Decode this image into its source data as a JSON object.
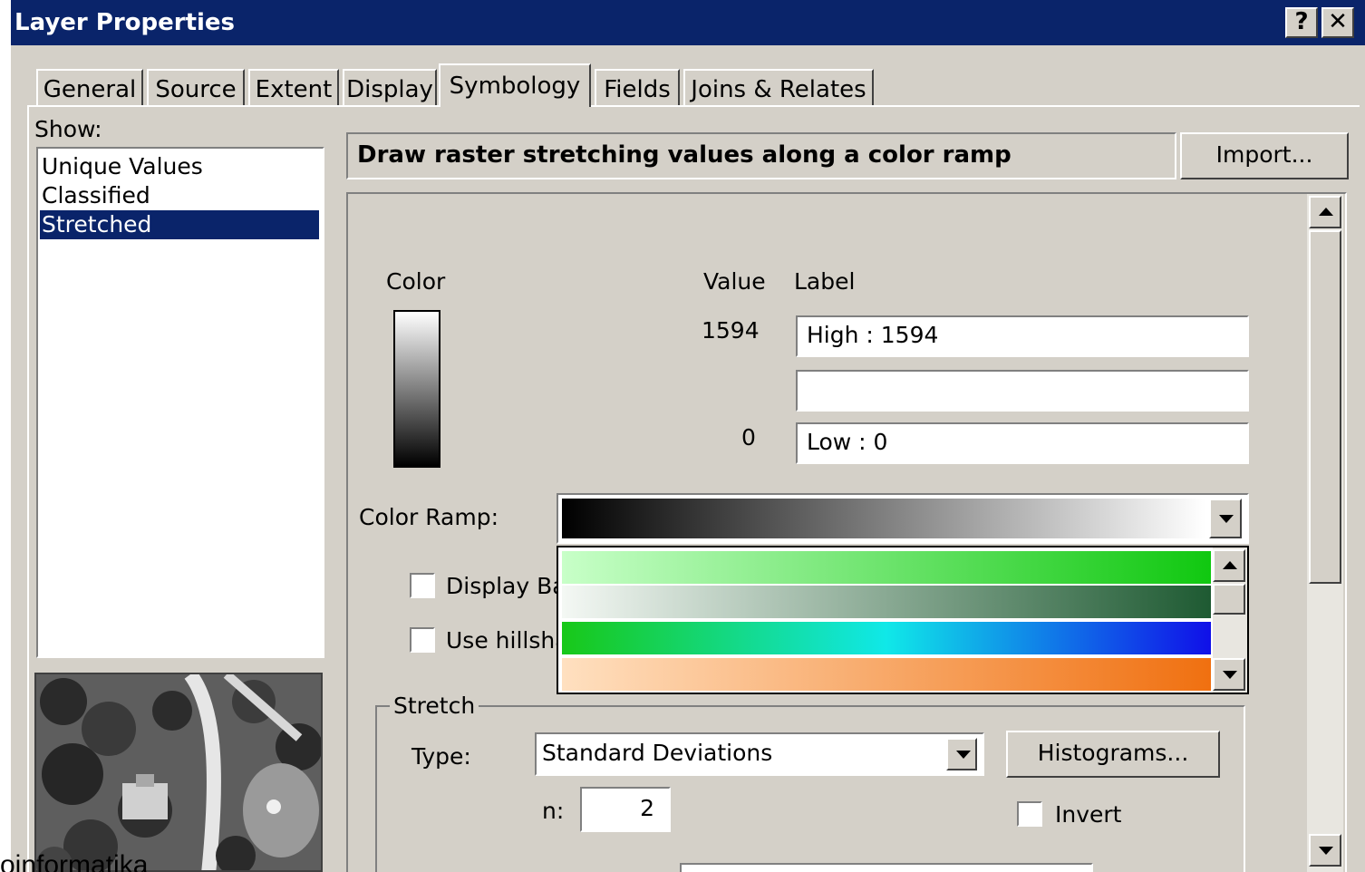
{
  "window": {
    "title": "Layer Properties",
    "help_label": "?",
    "close_label": "✕"
  },
  "tabs": [
    {
      "label": "General",
      "active": false
    },
    {
      "label": "Source",
      "active": false
    },
    {
      "label": "Extent",
      "active": false
    },
    {
      "label": "Display",
      "active": false
    },
    {
      "label": "Symbology",
      "active": true
    },
    {
      "label": "Fields",
      "active": false
    },
    {
      "label": "Joins & Relates",
      "active": false
    }
  ],
  "show": {
    "label": "Show:",
    "items": [
      {
        "label": "Unique Values",
        "selected": false
      },
      {
        "label": "Classified",
        "selected": false
      },
      {
        "label": "Stretched",
        "selected": true
      }
    ]
  },
  "header": {
    "description": "Draw raster stretching values along a color ramp",
    "import_label": "Import..."
  },
  "legend": {
    "color_header": "Color",
    "value_header": "Value",
    "label_header": "Label",
    "high_value": "1594",
    "high_label": "High : 1594",
    "mid_label": "",
    "low_value": "0",
    "low_label": "Low : 0"
  },
  "color_ramp": {
    "label": "Color Ramp:",
    "selected_colors": [
      "#000000",
      "#ffffff"
    ],
    "options": [
      {
        "name": "light-green-to-green",
        "colors": [
          "#c8ffc8",
          "#10c810"
        ]
      },
      {
        "name": "white-to-dark-green",
        "colors": [
          "#f4f8f4",
          "#1e5a32"
        ]
      },
      {
        "name": "green-cyan-blue",
        "colors": [
          "#18c818",
          "#10e8e8",
          "#1010e8"
        ]
      },
      {
        "name": "peach-to-orange",
        "colors": [
          "#ffe0c0",
          "#f07010"
        ]
      }
    ]
  },
  "options": {
    "display_background_label": "Display Ba",
    "use_hillshade_label": "Use hillsha"
  },
  "stretch": {
    "group_label": "Stretch",
    "type_label": "Type:",
    "type_value": "Standard Deviations",
    "histograms_label": "Histograms...",
    "n_label": "n:",
    "n_value": "2",
    "invert_label": "Invert"
  },
  "watermark": "oinformatika"
}
